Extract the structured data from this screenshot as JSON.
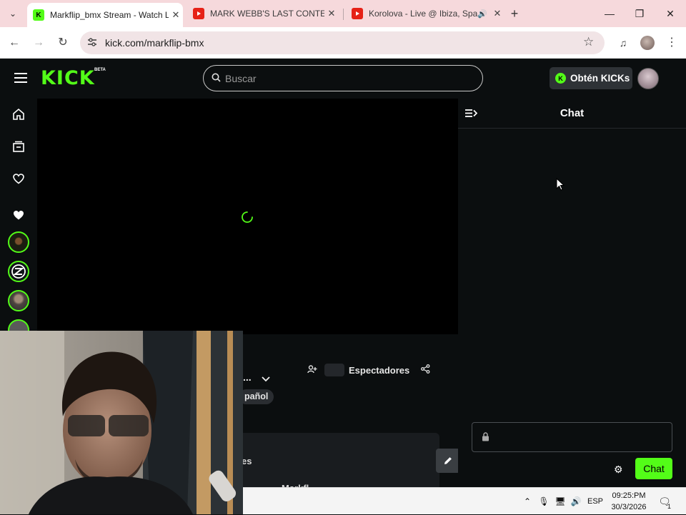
{
  "browser": {
    "tabs": [
      {
        "title": "Markflip_bmx Stream - Watch L",
        "favicon": "kick-favicon",
        "active": true
      },
      {
        "title": "MARK WEBB'S LAST CONTEST L",
        "favicon": "youtube-favicon",
        "active": false
      },
      {
        "title": "Korolova - Live @ Ibiza, Spa",
        "favicon": "youtube-favicon",
        "active": false,
        "audio": true
      }
    ],
    "new_tab_symbol": "+",
    "url": "kick.com/markflip-bmx",
    "window_controls": {
      "minimize": "—",
      "restore": "❐",
      "close": "✕"
    }
  },
  "kick": {
    "logo_text": "KICK",
    "logo_badge": "BETA",
    "search": {
      "placeholder": "Buscar"
    },
    "get_kicks_label": "Obtén KICKs",
    "accent_color": "#53fc18",
    "sidebar_icons": [
      "menu-icon",
      "home-icon",
      "browse-icon",
      "following-heart-icon",
      "followed-heart-icon"
    ]
  },
  "stream": {
    "title_truncated": "...",
    "viewers_label": "Espectadores",
    "language_tag": "pañol",
    "about_label": "es",
    "cut_text": "Markfl..."
  },
  "chat": {
    "title": "Chat",
    "send_label": "Chat",
    "input_placeholder": ""
  },
  "taskbar": {
    "language": "ESP",
    "time": "09:25:PM",
    "date": "30/3/2026",
    "notification_count": "1"
  }
}
